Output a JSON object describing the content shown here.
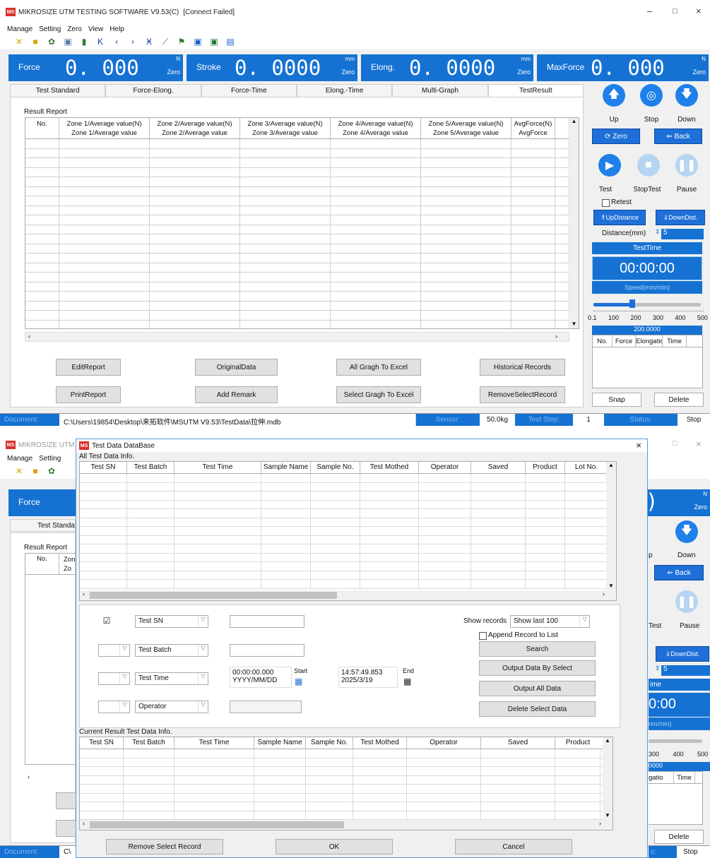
{
  "app": {
    "logo": "MS",
    "title": "MIKROSIZE UTM TESTING SOFTWARE V9.53(C)",
    "connection": "[Connect Failed]",
    "minimize": "–",
    "maximize": "□",
    "close": "×"
  },
  "menu": [
    "Manage",
    "Setting",
    "Zero",
    "View",
    "Help"
  ],
  "toolbar_icons": [
    "tools-icon",
    "open-folder-icon",
    "settings-gear-icon",
    "report-icon",
    "delete-icon",
    "first-icon",
    "prev-icon",
    "next-icon",
    "last-icon",
    "curve-icon",
    "flag-icon",
    "save-icon",
    "excel-icon",
    "export-icon"
  ],
  "readouts": [
    {
      "label": "Force",
      "value": "0. 000",
      "unit": "N",
      "zero": "Zero"
    },
    {
      "label": "Stroke",
      "value": "0. 0000",
      "unit": "mm",
      "zero": "Zero"
    },
    {
      "label": "Elong.",
      "value": "0. 0000",
      "unit": "mm",
      "zero": "Zero"
    },
    {
      "label": "MaxForce",
      "value": "0. 000",
      "unit": "N",
      "zero": "Zero"
    }
  ],
  "tabs": [
    "Test Standard",
    "Force-Elong.",
    "Force-Time",
    "Elong.-Time",
    "Multi-Graph",
    "TestResult"
  ],
  "report": {
    "title": "Result Report",
    "columns": [
      {
        "top": "No.",
        "bottom": ""
      },
      {
        "top": "Zone 1/Average value(N)",
        "bottom": "Zone 1/Average value"
      },
      {
        "top": "Zone 2/Average value(N)",
        "bottom": "Zone 2/Average value"
      },
      {
        "top": "Zone 3/Average value(N)",
        "bottom": "Zone 3/Average value"
      },
      {
        "top": "Zone 4/Average value(N)",
        "bottom": "Zone 4/Average value"
      },
      {
        "top": "Zone 5/Average value(N)",
        "bottom": "Zone 5/Average value"
      },
      {
        "top": "AvgForce(N)",
        "bottom": "AvgForce"
      }
    ],
    "buttons": {
      "edit": "EditReport",
      "original": "OriginalData",
      "all_excel": "All Gragh To Excel",
      "historical": "Historical Records",
      "print": "PrintReport",
      "remark": "Add Remark",
      "select_excel": "Select Gragh To Excel",
      "remove": "RemoveSelectRecord"
    }
  },
  "control": {
    "up": "Up",
    "stop": "Stop",
    "down": "Down",
    "zero": "Zero",
    "back": "Back",
    "test": "Test",
    "stoptest": "StopTest",
    "pause": "Pause",
    "retest": "Retest",
    "up_distance": "UpDistance",
    "down_distance": "DownDist.",
    "distance_label": "Distance(mm)",
    "distance_value": "5",
    "test_time_label": "TestTime",
    "test_time": "00:00:00",
    "speed_label": "Speed(mm/min)",
    "speed_ticks": [
      "0.1",
      "100",
      "200",
      "300",
      "400",
      "500"
    ],
    "speed_value": "200.0000",
    "speed_fraction": 0.36,
    "mini_cols": [
      "No.",
      "Force",
      "Elongation",
      "Time"
    ],
    "snap": "Snap",
    "delete": "Delete"
  },
  "status": {
    "doc_label": "Document:",
    "path": "C:\\Users\\19854\\Desktop\\来拓软件\\MSUTM V9.53\\TestData\\拉伸.mdb",
    "sensor_label": "Sensor:",
    "sensor": "50.0kg",
    "step_label": "Test Step:",
    "step": "1",
    "status_label": "Status:",
    "state": "Stop"
  },
  "dialog": {
    "logo": "MS",
    "title": "Test Data DataBase",
    "close": "×",
    "all_label": "All Test Data Info.",
    "all_cols": [
      "Test SN",
      "Test Batch",
      "Test Time",
      "Sample Name",
      "Sample No.",
      "Test Mothed",
      "Operator",
      "Saved",
      "Product",
      "Lot No."
    ],
    "filter1": "Test SN",
    "filter2": "Test Batch",
    "filter3": "Test Time",
    "filter4": "Operator",
    "start_time": "00:00:00.000",
    "start_date": "YYYY/MM/DD",
    "start_label": "Start",
    "end_time": "14:57:49.853",
    "end_date": "2025/3/19",
    "end_label": "End",
    "show_records_label": "Show records",
    "show_records_value": "Show last 100",
    "append_label": "Append Record to List",
    "search": "Search",
    "output_select": "Output Data By Select",
    "output_all": "Output All Data",
    "delete_select": "Delete Select Data",
    "current_label": "Current Result Test Data Info.",
    "cur_cols": [
      "Test SN",
      "Test Batch",
      "Test Time",
      "Sample Name",
      "Sample No.",
      "Test Mothed",
      "Operator",
      "Saved",
      "Product"
    ],
    "remove": "Remove Select Record",
    "ok": "OK",
    "cancel": "Cancel"
  },
  "bg2": {
    "menu": [
      "Manage",
      "Setting"
    ],
    "force_label": "Force",
    "test_standard_partial": "Test Standa",
    "result_report": "Result Report",
    "no": "No.",
    "zone_partial1": "Zon",
    "zone_partial2": "Zo",
    "unit": "N",
    "zero": "Zero",
    "down": "Down",
    "back": "Back",
    "pause": "Pause",
    "test": "Test",
    "downdist": "DownDist.",
    "dist_val": "5",
    "time_partial": "ime",
    "timer_partial": "0:00",
    "speed_partial": "nm/min)",
    "ticks_partial": [
      "300",
      "400",
      "500"
    ],
    "speed_partial_value": "0000",
    "col_partial": "gatio",
    "col_time": "Time",
    "delete": "Delete",
    "stop": "Stop",
    "doc": "Document:",
    "c_partial": "C\\"
  }
}
